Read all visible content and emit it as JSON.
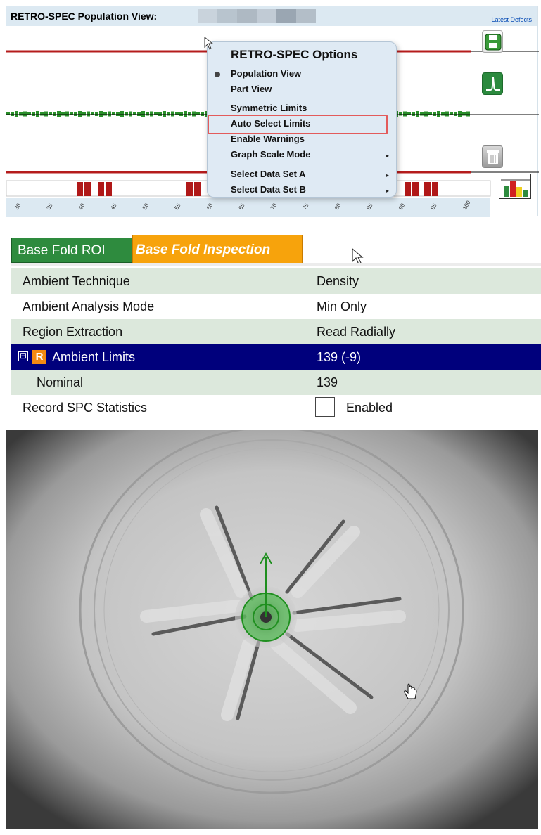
{
  "chart_panel": {
    "title": "RETRO-SPEC Population View:",
    "latest_defects": "Latest Defects",
    "x_ticks": [
      "30",
      "35",
      "40",
      "45",
      "50",
      "55",
      "60",
      "65",
      "70",
      "75",
      "80",
      "85",
      "90",
      "95",
      "100"
    ],
    "colors": {
      "titlebar": "#dce9f2",
      "limit_line": "#b51c1c",
      "trend": "#2a8f2a",
      "defect_bar": "#b01818"
    },
    "icons": [
      "save-icon",
      "peak-icon",
      "trash-icon",
      "histogram-icon"
    ]
  },
  "context_menu": {
    "title": "RETRO-SPEC Options",
    "items": [
      {
        "label": "Population View",
        "selected": true
      },
      {
        "label": "Part View"
      },
      {
        "label": "Symmetric Limits"
      },
      {
        "label": "Auto Select Limits",
        "highlighted": true
      },
      {
        "label": "Enable Warnings"
      },
      {
        "label": "Graph Scale Mode",
        "submenu": true
      },
      {
        "label": "Select Data Set A",
        "submenu": true
      },
      {
        "label": "Select Data Set B",
        "submenu": true
      }
    ]
  },
  "tabs": [
    {
      "label": "Base Fold ROI",
      "color": "#2e8b3e"
    },
    {
      "label": "Base Fold Inspection",
      "color": "#f7a30c",
      "active": true
    }
  ],
  "properties": [
    {
      "name": "Ambient Technique",
      "value": "Density"
    },
    {
      "name": "Ambient Analysis Mode",
      "value": "Min Only"
    },
    {
      "name": "Region Extraction",
      "value": "Read Radially"
    },
    {
      "name": "Ambient Limits",
      "value": "139 (-9)",
      "selected": true,
      "badge": "R",
      "expander": "⊟"
    },
    {
      "name": "Nominal",
      "value": "139"
    },
    {
      "name": "Record SPC Statistics",
      "value": "Enabled",
      "checked": false
    }
  ],
  "camera": {
    "description_icon": "bottle-base-image",
    "overlay_color": "#2bb52b"
  }
}
